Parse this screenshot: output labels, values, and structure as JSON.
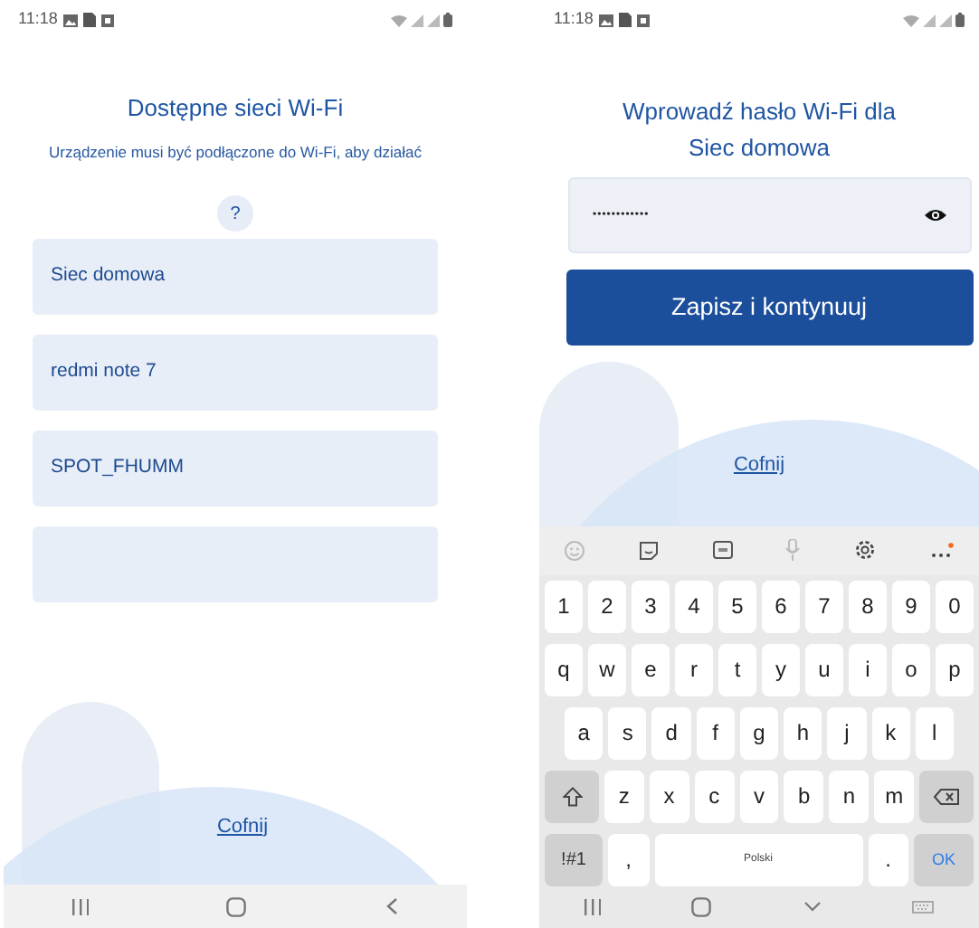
{
  "network_list_screen": {
    "status_bar": {
      "time": "11:18"
    },
    "title": "Dostępne sieci Wi-Fi",
    "subtitle": "Urządzenie musi być podłączone do Wi-Fi, aby działać",
    "help_button": "?",
    "networks": [
      {
        "kind": "network",
        "name": "Siec domowa"
      },
      {
        "kind": "network",
        "name": "redmi note 7"
      },
      {
        "kind": "network",
        "name": "SPOT_FHUMM"
      },
      {
        "kind": "empty"
      }
    ],
    "back_link": "Cofnij"
  },
  "password_screen": {
    "status_bar": {
      "time": "11:18"
    },
    "title": "Wprowadź hasło Wi-Fi dla",
    "network_name": "Siec domowa",
    "password_field": {
      "value": "••••••••••••"
    },
    "save_button": "Zapisz i kontynuuj",
    "back_link": "Cofnij",
    "keyboard": {
      "rows": [
        [
          {
            "kind": "char",
            "label": "1"
          },
          {
            "kind": "char",
            "label": "2"
          },
          {
            "kind": "char",
            "label": "3"
          },
          {
            "kind": "char",
            "label": "4"
          },
          {
            "kind": "char",
            "label": "5"
          },
          {
            "kind": "char",
            "label": "6"
          },
          {
            "kind": "char",
            "label": "7"
          },
          {
            "kind": "char",
            "label": "8"
          },
          {
            "kind": "char",
            "label": "9"
          },
          {
            "kind": "char",
            "label": "0"
          }
        ],
        [
          {
            "kind": "char",
            "label": "q"
          },
          {
            "kind": "char",
            "label": "w"
          },
          {
            "kind": "char",
            "label": "e"
          },
          {
            "kind": "char",
            "label": "r"
          },
          {
            "kind": "char",
            "label": "t"
          },
          {
            "kind": "char",
            "label": "y"
          },
          {
            "kind": "char",
            "label": "u"
          },
          {
            "kind": "char",
            "label": "i"
          },
          {
            "kind": "char",
            "label": "o"
          },
          {
            "kind": "char",
            "label": "p"
          }
        ],
        [
          {
            "kind": "char",
            "label": "a"
          },
          {
            "kind": "char",
            "label": "s"
          },
          {
            "kind": "char",
            "label": "d"
          },
          {
            "kind": "char",
            "label": "f"
          },
          {
            "kind": "char",
            "label": "g"
          },
          {
            "kind": "char",
            "label": "h"
          },
          {
            "kind": "char",
            "label": "j"
          },
          {
            "kind": "char",
            "label": "k"
          },
          {
            "kind": "char",
            "label": "l"
          }
        ],
        [
          {
            "kind": "shift"
          },
          {
            "kind": "char",
            "label": "z"
          },
          {
            "kind": "char",
            "label": "x"
          },
          {
            "kind": "char",
            "label": "c"
          },
          {
            "kind": "char",
            "label": "v"
          },
          {
            "kind": "char",
            "label": "b"
          },
          {
            "kind": "char",
            "label": "n"
          },
          {
            "kind": "char",
            "label": "m"
          },
          {
            "kind": "backspace"
          }
        ],
        [
          {
            "kind": "symbols",
            "label": "!#1"
          },
          {
            "kind": "char",
            "label": ","
          },
          {
            "kind": "space",
            "label": "Polski"
          },
          {
            "kind": "char",
            "label": "."
          },
          {
            "kind": "enter",
            "label": "OK"
          }
        ]
      ]
    }
  }
}
